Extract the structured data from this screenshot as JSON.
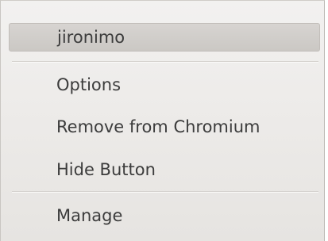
{
  "menu": {
    "items": [
      {
        "label": "jironimo"
      },
      {
        "label": "Options"
      },
      {
        "label": "Remove from Chromium"
      },
      {
        "label": "Hide Button"
      },
      {
        "label": "Manage"
      }
    ]
  }
}
